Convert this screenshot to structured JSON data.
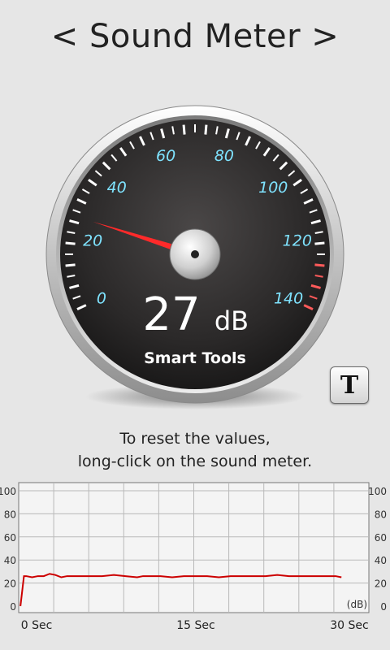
{
  "header": {
    "prev_arrow": "<",
    "title": "Sound Meter",
    "next_arrow": ">"
  },
  "gauge": {
    "scale_labels": [
      "0",
      "20",
      "40",
      "60",
      "80",
      "100",
      "120",
      "140"
    ],
    "scale_min": 0,
    "scale_max": 140,
    "needle_value": 26,
    "reading_value": "27",
    "reading_unit": "dB",
    "brand": "Smart Tools",
    "label_color": "#7fe3ff",
    "needle_color": "#ff2a2a",
    "danger_color": "#ff5a5a"
  },
  "text_button": {
    "label": "T"
  },
  "hint": {
    "line1": "To reset the values,",
    "line2": "long-click on the sound meter."
  },
  "chart_data": {
    "type": "line",
    "y_ticks": [
      "100",
      "80",
      "60",
      "40",
      "20",
      "0"
    ],
    "x_ticks": [
      "0 Sec",
      "15 Sec",
      "30 Sec"
    ],
    "unit_label": "(dB)",
    "ylim": [
      0,
      100
    ],
    "xlim": [
      0,
      30
    ],
    "series": [
      {
        "color": "#cc0000",
        "x": [
          0,
          0.3,
          0.5,
          1,
          1.5,
          2,
          2.5,
          3,
          3.5,
          4,
          4.5,
          5,
          6,
          7,
          8,
          9,
          10,
          10.5,
          11,
          12,
          13,
          14,
          15,
          16,
          17,
          18,
          19,
          20,
          21,
          22,
          23,
          24,
          25,
          26,
          27,
          27.5
        ],
        "y": [
          0,
          26,
          26,
          25,
          26,
          26,
          28,
          27,
          25,
          26,
          26,
          26,
          26,
          26,
          27,
          26,
          25,
          26,
          26,
          26,
          25,
          26,
          26,
          26,
          25,
          26,
          26,
          26,
          26,
          27,
          26,
          26,
          26,
          26,
          26,
          25
        ]
      }
    ]
  }
}
